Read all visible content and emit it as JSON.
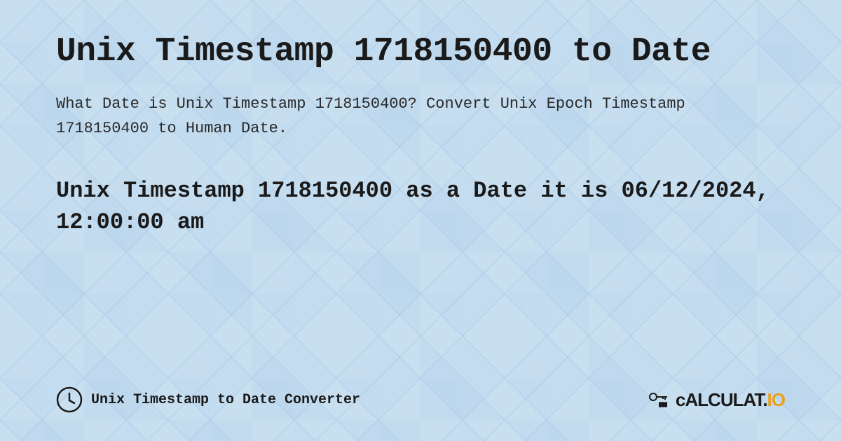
{
  "page": {
    "title": "Unix Timestamp 1718150400 to Date",
    "description": "What Date is Unix Timestamp 1718150400? Convert Unix Epoch Timestamp 1718150400 to Human Date.",
    "result": "Unix Timestamp 1718150400 as a Date it is 06/12/2024, 12:00:00 am",
    "background_color": "#c8dff0"
  },
  "footer": {
    "label": "Unix Timestamp to Date Converter",
    "logo_text": "CALCULAT.IO"
  }
}
